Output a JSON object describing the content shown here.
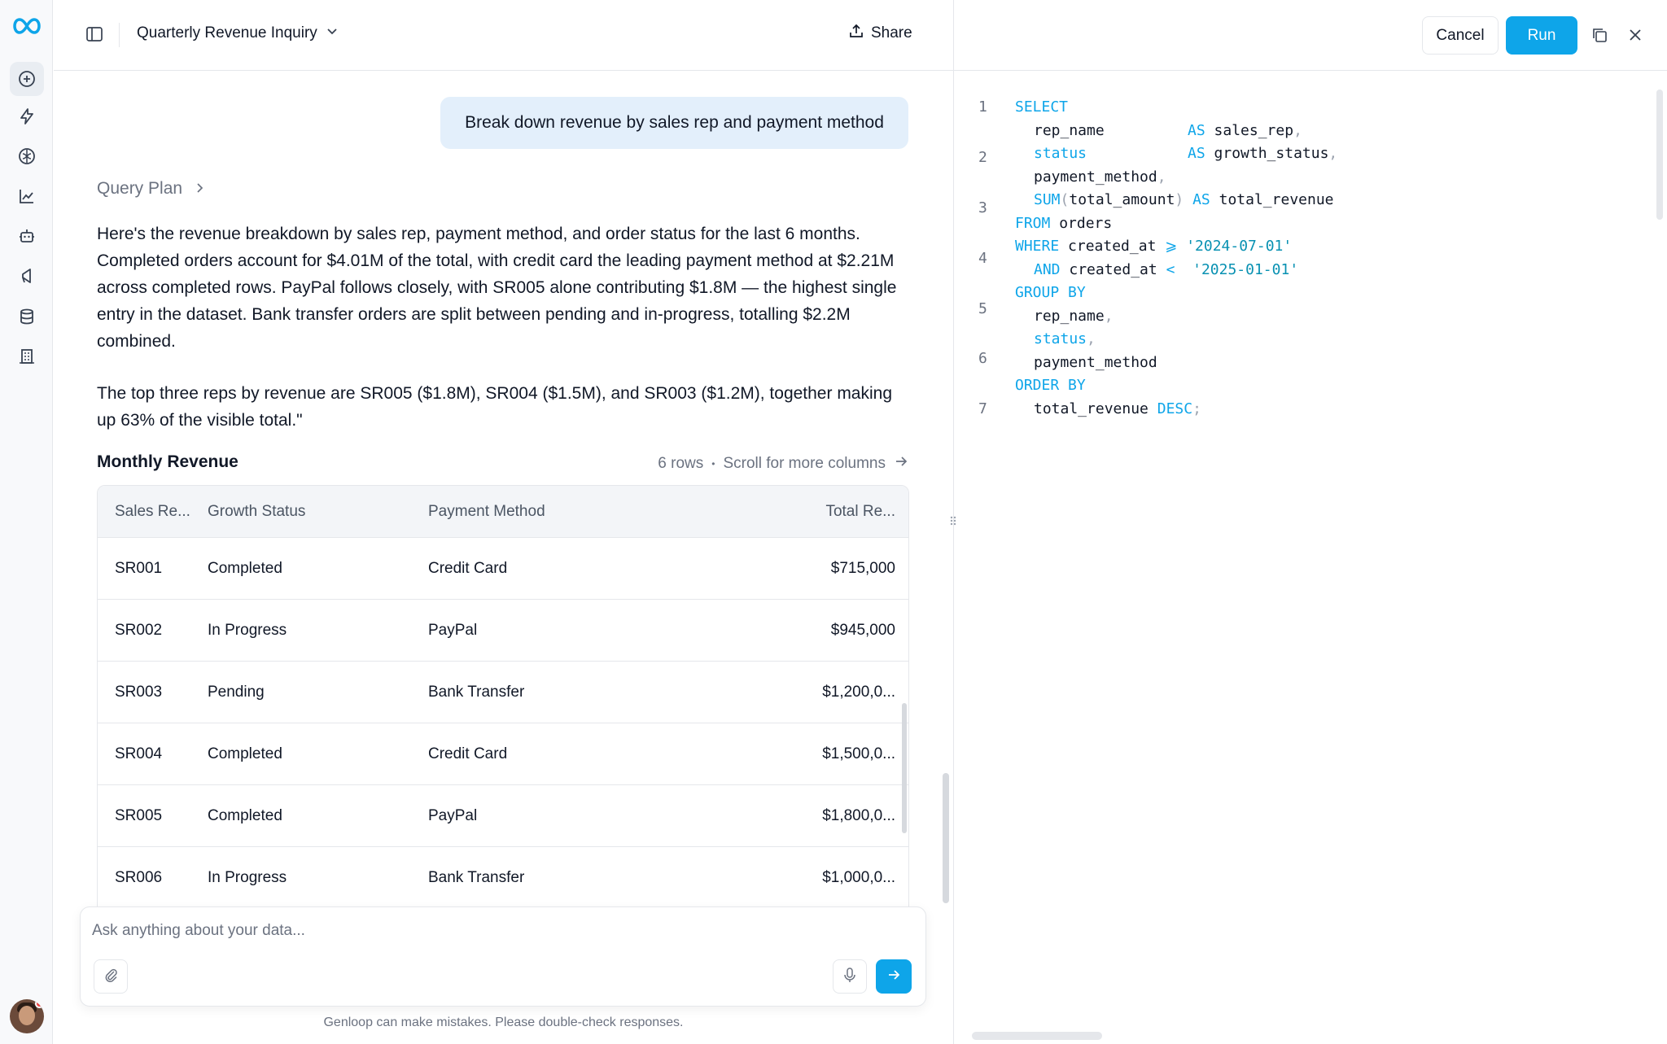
{
  "topbar": {
    "title": "Quarterly Revenue Inquiry",
    "share_label": "Share"
  },
  "chat": {
    "user_message": "Break down revenue by sales rep and payment method",
    "query_plan_label": "Query Plan",
    "answer_p1": "Here's the revenue breakdown by sales rep, payment method, and order status for the last 6 months. Completed orders account for $4.01M of the total, with credit card the leading payment method at $2.21M across completed rows. PayPal follows closely, with SR005 alone contributing $1.8M — the highest single entry in the dataset. Bank transfer orders are split between pending and in-progress, totalling $2.2M combined.",
    "answer_p2": "The top three reps by revenue are SR005 ($1.8M), SR004 ($1.5M), and SR003 ($1.2M), together making up 63% of the visible total.\""
  },
  "table": {
    "title": "Monthly Revenue",
    "rows_count": "6 rows",
    "meta_separator": "•",
    "scroll_hint": "Scroll for more columns",
    "headers": [
      "Sales Re...",
      "Growth Status",
      "Payment Method",
      "Total Re..."
    ],
    "rows": [
      [
        "SR001",
        "Completed",
        "Credit Card",
        "$715,000"
      ],
      [
        "SR002",
        "In Progress",
        "PayPal",
        "$945,000"
      ],
      [
        "SR003",
        "Pending",
        "Bank Transfer",
        "$1,200,0..."
      ],
      [
        "SR004",
        "Completed",
        "Credit Card",
        "$1,500,0..."
      ],
      [
        "SR005",
        "Completed",
        "PayPal",
        "$1,800,0..."
      ],
      [
        "SR006",
        "In Progress",
        "Bank Transfer",
        "$1,000,0..."
      ]
    ]
  },
  "composer": {
    "placeholder": "Ask anything about your data...",
    "disclaimer": "Genloop can make mistakes. Please double-check responses."
  },
  "editor": {
    "cancel_label": "Cancel",
    "run_label": "Run",
    "line_numbers": [
      "1",
      "2",
      "3",
      "4",
      "5",
      "6",
      "7"
    ],
    "code": {
      "select_kw": "SELECT",
      "rep_name": "rep_name",
      "as1": "AS",
      "sales_rep": "sales_rep",
      "status_col": "status",
      "as2": "AS",
      "growth_status": "growth_status",
      "payment_method": "payment_method",
      "sum_fn": "SUM",
      "sum_arg": "total_amount",
      "as3": "AS",
      "total_revenue": "total_revenue",
      "from_kw": "FROM",
      "orders": "orders",
      "where_kw": "WHERE",
      "created_at1": "created_at",
      "gte": "⩾",
      "date1": "'2024-07-01'",
      "and_kw": "AND",
      "created_at2": "created_at",
      "lt": "<",
      "date2": "'2025-01-01'",
      "group_by_kw": "GROUP BY",
      "g_rep_name": "rep_name",
      "g_status": "status",
      "g_payment": "payment_method",
      "order_by_kw": "ORDER BY",
      "o_total": "total_revenue",
      "desc_kw": "DESC"
    }
  },
  "colors": {
    "accent": "#0ea5e9",
    "user_bubble": "#e3effb"
  }
}
